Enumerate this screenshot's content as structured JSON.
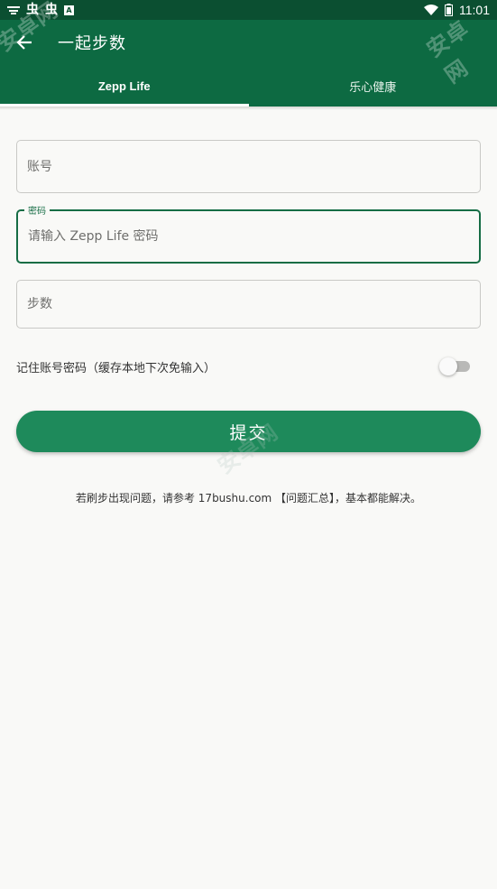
{
  "status_bar": {
    "left_glyphs": [
      "虫",
      "虫"
    ],
    "badge": "A",
    "time": "11:01"
  },
  "toolbar": {
    "title": "一起步数",
    "back_icon": "arrow-left-icon"
  },
  "tabs": [
    {
      "label": "Zepp Life",
      "active": true
    },
    {
      "label": "乐心健康",
      "active": false
    }
  ],
  "form": {
    "account": {
      "placeholder": "账号",
      "value": ""
    },
    "password": {
      "label": "密码",
      "placeholder": "请输入 Zepp Life 密码",
      "value": ""
    },
    "steps": {
      "placeholder": "步数",
      "value": ""
    }
  },
  "remember": {
    "label": "记住账号密码（缓存本地下次免输入）",
    "checked": false
  },
  "submit": {
    "label": "提交"
  },
  "hint": "若刷步出现问题，请参考 17bushu.com 【问题汇总】，基本都能解决。",
  "watermark": "安卓网",
  "colors": {
    "status_bar": "#0b4f31",
    "toolbar": "#0d6a42",
    "accent": "#166d45",
    "button": "#1e8a5b",
    "background": "#f9f9f7"
  }
}
